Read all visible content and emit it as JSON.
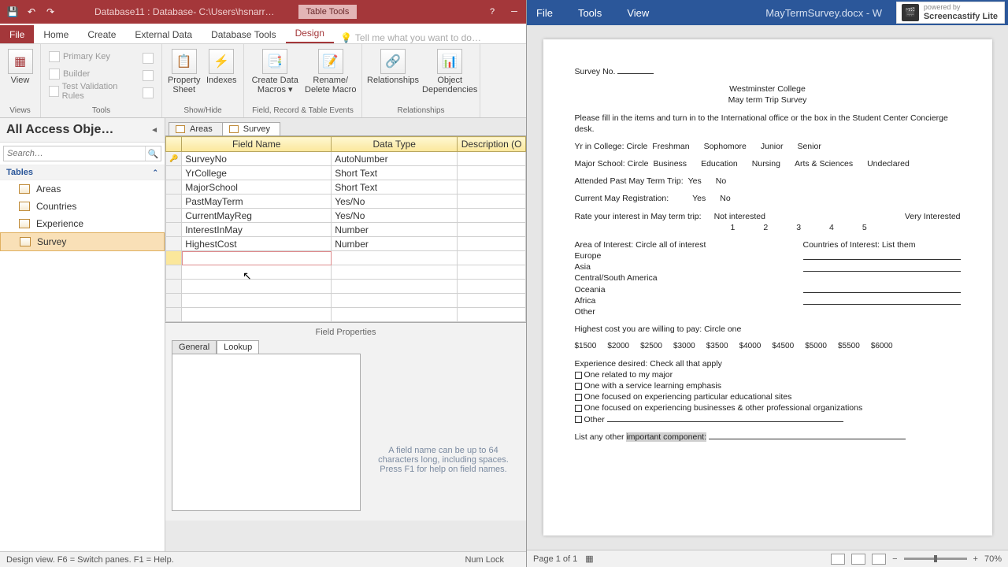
{
  "access": {
    "titlebar": {
      "title": "Database11 : Database- C:\\Users\\hsnarr…",
      "tabtools": "Table Tools"
    },
    "tabs": {
      "file": "File",
      "home": "Home",
      "create": "Create",
      "external": "External Data",
      "dbtools": "Database Tools",
      "design": "Design",
      "tell": "Tell me what you want to do…"
    },
    "ribbon": {
      "views": {
        "view": "View",
        "group": "Views"
      },
      "tools": {
        "primary": "Primary Key",
        "builder": "Builder",
        "test": "Test Validation Rules",
        "group": "Tools"
      },
      "showhide": {
        "property": "Property\nSheet",
        "indexes": "Indexes",
        "group": "Show/Hide"
      },
      "events": {
        "macros": "Create Data\nMacros ▾",
        "rename": "Rename/\nDelete Macro",
        "group": "Field, Record & Table Events"
      },
      "rel": {
        "relationships": "Relationships",
        "objdep": "Object\nDependencies",
        "group": "Relationships"
      }
    },
    "nav": {
      "hdr": "All Access Obje…",
      "search": "Search…",
      "sect": "Tables",
      "items": [
        "Areas",
        "Countries",
        "Experience",
        "Survey"
      ]
    },
    "design": {
      "tabs": [
        "Areas",
        "Survey"
      ],
      "headers": {
        "fn": "Field Name",
        "dt": "Data Type",
        "desc": "Description (O"
      },
      "rows": [
        {
          "fn": "SurveyNo",
          "dt": "AutoNumber",
          "key": true
        },
        {
          "fn": "YrCollege",
          "dt": "Short Text"
        },
        {
          "fn": "MajorSchool",
          "dt": "Short Text"
        },
        {
          "fn": "PastMayTerm",
          "dt": "Yes/No"
        },
        {
          "fn": "CurrentMayReg",
          "dt": "Yes/No"
        },
        {
          "fn": "InterestInMay",
          "dt": "Number"
        },
        {
          "fn": "HighestCost",
          "dt": "Number"
        }
      ],
      "props": {
        "title": "Field Properties",
        "tabs": [
          "General",
          "Lookup"
        ],
        "help": "A field name can be up to 64 characters long, including spaces. Press F1 for help on field names."
      }
    },
    "status": {
      "left": "Design view.   F6 = Switch panes.   F1 = Help.",
      "numlock": "Num Lock"
    }
  },
  "word": {
    "menu": {
      "file": "File",
      "tools": "Tools",
      "view": "View"
    },
    "filename": "MayTermSurvey.docx - W",
    "doc": {
      "surveyno": "Survey No.",
      "h1": "Westminster College",
      "h2": "May term Trip Survey",
      "intro": "Please fill in the items and turn in to the International office or the box in the Student Center Concierge desk.",
      "yr_label": "Yr in College: Circle",
      "yr_opts": [
        "Freshman",
        "Sophomore",
        "Junior",
        "Senior"
      ],
      "major_label": "Major School: Circle",
      "major_opts": [
        "Business",
        "Education",
        "Nursing",
        "Arts & Sciences",
        "Undeclared"
      ],
      "past_label": "Attended Past May  Term Trip:",
      "yn": [
        "Yes",
        "No"
      ],
      "curreg_label": "Current May  Registration:",
      "rate_label": "Rate your interest in May term trip:",
      "rate_left": "Not interested",
      "rate_right": "Very Interested",
      "rate_nums": [
        "1",
        "2",
        "3",
        "4",
        "5"
      ],
      "area_label": "Area of Interest: Circle all of interest",
      "areas": [
        "Europe",
        "Asia",
        "Central/South America",
        "Oceania",
        "Africa",
        "Other"
      ],
      "countries_label": "Countries of Interest:  List them",
      "cost_label": "Highest cost you are willing to pay: Circle one",
      "costs": [
        "$1500",
        "$2000",
        "$2500",
        "$3000",
        "$3500",
        "$4000",
        "$4500",
        "$5000",
        "$5500",
        "$6000"
      ],
      "exp_label": "Experience desired: Check all that apply",
      "exps": [
        "One related to my major",
        "One with a service learning emphasis",
        "One focused on experiencing particular educational sites",
        "One focused on experiencing businesses & other professional organizations",
        "Other"
      ],
      "list_label": "List any  other ",
      "list_hl": "important component:"
    },
    "status": {
      "page": "Page 1 of 1",
      "zoom": "70%"
    }
  },
  "watermark": {
    "small": "powered by",
    "brand": "Screencastify Lite"
  }
}
